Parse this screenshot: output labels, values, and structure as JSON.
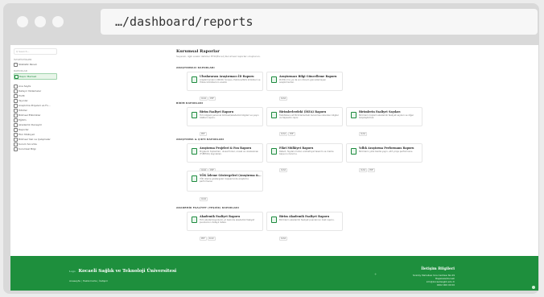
{
  "browser": {
    "url": "…/dashboard/reports"
  },
  "sidebar": {
    "search_placeholder": "Q Search...",
    "sections": [
      {
        "title": "İSTATİSTİKLER",
        "items": [
          {
            "label": "İstatistik Paneli",
            "active": false
          }
        ]
      },
      {
        "title": "RAPORLAR",
        "items": [
          {
            "label": "Rapor Merkezi",
            "active": true
          }
        ]
      }
    ],
    "items": [
      "Ana Sayfa",
      "Detaylı Yüklemeler",
      "Profil",
      "Yayınlar",
      "Araştırma Projeleri ve Fo...",
      "Ödüller",
      "Bilimsel Etkinlikler",
      "Eğitim",
      "Akademik Deneyim",
      "Raporlar",
      "Fikri Mülkiyet",
      "Bilimsel Yazı ve Çalışmalar",
      "Kurum Sorumlu",
      "Kurumsal Bilgi"
    ]
  },
  "main": {
    "title": "Kurumsal Raporlar",
    "subtitle": "Seçerek, ilgili analiz dahiller ETKİ(Excel) Kurumsal raporları oluşturun.",
    "sections": [
      {
        "title": "ARAŞTIRMACI RAPORLARI",
        "cards": [
          {
            "title": "Uluslararası Araştırmacı İD Raporu",
            "desc": "Araştırmacıların ORCID, Scopus, Publons/WoS kimlikleri ve Yöksis kimliklerinin analizi.",
            "tags": [
              "XLSX",
              "PDF"
            ]
          },
          {
            "title": "Araştırmacı Bilgi Güncelleme Raporu",
            "desc": "Profilini hiç ya da son dönem güncellemeyen araştırmacılar.",
            "tags": [
              "XLSX"
            ]
          }
        ]
      },
      {
        "title": "BİRİM RAPORLARI",
        "cards": [
          {
            "title": "Birim Faaliyet Raporu",
            "desc": "Tüm bilgisiz personel bilimsel/akademik bilgileri ve yayın özetleri raporu.",
            "tags": [
              "PDF"
            ]
          },
          {
            "title": "Birimlerlerdeki (İSEA) Raporu",
            "desc": "Fakültelere ait Birimlerlerdeki bulunması istenilen bilgiler ve Kapsamlı rapor.",
            "tags": [
              "XLSX",
              "PDF"
            ]
          },
          {
            "title": "Birimlerin Faaliyet Sayıları",
            "desc": "Birimlerin toplam akademik faaliyet sayıları ve diğer karşılaştırmalı.",
            "tags": [
              "XLSX"
            ]
          }
        ]
      },
      {
        "title": "ARAŞTIRMA & ÇIKTI RAPORLARI",
        "cards": [
          {
            "title": "Araştırma Projeleri & Fon Raporu",
            "desc": "Projelerin toplamları, ulusal fonlar, ulusal ve uluslararası (TÜBİTAK) kaynakları.",
            "tags": [
              "XLSX",
              "PDF"
            ]
          },
          {
            "title": "Fikri Mülkiyet Raporu",
            "desc": "Patent, faydalı model, endüstriyel tasarım ve marka başvuru durumu.",
            "tags": [
              "XLSX"
            ]
          },
          {
            "title": "Yıllık Araştırma Performans Raporu",
            "desc": "Birimlerin yıllık bazda yayın, atıf, proje performansı.",
            "tags": [
              "XLSX",
              "PDF"
            ]
          },
          {
            "title": "YÖK İzleme Göstergeleri (Araştırma &...",
            "desc": "YÖK izleme göstergeleri kapsamında araştırma performansı.",
            "tags": [
              "XLSX"
            ]
          }
        ]
      },
      {
        "title": "AKADEMİK FAALİYET (TEŞVİK) RAPORLARI",
        "cards": [
          {
            "title": "Akademik Faaliyet Raporu",
            "desc": "Tüm akademisyenlerin yıl bazında akademik faaliyet puanlarının detaylı listesi.",
            "tags": [
              "PDF",
              "XLSX"
            ]
          },
          {
            "title": "Birim Akademik Faaliyet Raporu",
            "desc": "Birimlerin akademik faaliyet puanlarının özet raporu.",
            "tags": [
              "XLSX"
            ]
          }
        ]
      }
    ]
  },
  "footer": {
    "logo_alt": "Logo",
    "university": "Kocaeli Sağlık ve Teknoloji Üniversitesi",
    "links": [
      "Anasayfa",
      "Hakkımızda",
      "İletişim"
    ],
    "contact_title": "İletişim Bilgileri",
    "contact_lines": [
      "Yeniköy Mahallesi Ilıca Caddesi No:29",
      "Başiskele/Kocaeli",
      "info@kocaelisaglik.edu.tr",
      "0262 000 00 00"
    ]
  },
  "colors": {
    "accent": "#1e8f3d",
    "active_bg": "#e8f5e9",
    "browser_chrome": "#d9d9d9"
  }
}
